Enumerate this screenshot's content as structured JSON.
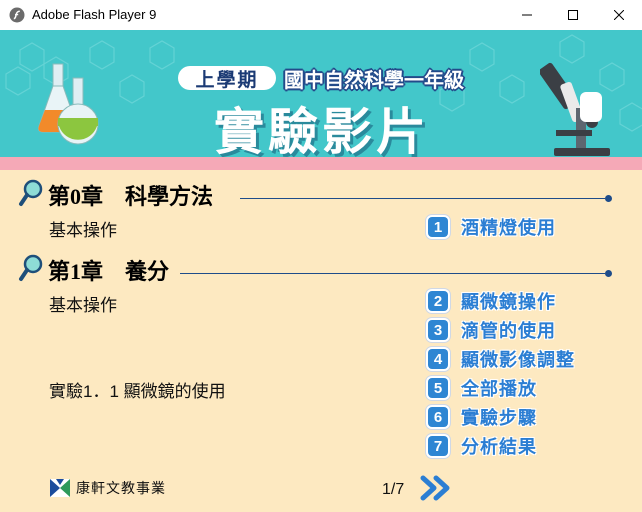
{
  "window": {
    "title": "Adobe Flash Player 9",
    "controls": [
      "minimize",
      "maximize",
      "close"
    ]
  },
  "banner": {
    "semester": "上學期",
    "course": "國中自然科學一年級",
    "title": "實驗影片"
  },
  "chapters": [
    {
      "title": "第0章　科學方法",
      "sections": [
        {
          "label": "基本操作"
        }
      ],
      "lessons": [
        {
          "num": "1",
          "label": "酒精燈使用"
        }
      ]
    },
    {
      "title": "第1章　養分",
      "sections": [
        {
          "label": "基本操作"
        },
        {
          "label": "實驗1．1 顯微鏡的使用"
        }
      ],
      "lessons": [
        {
          "num": "2",
          "label": "顯微鏡操作"
        },
        {
          "num": "3",
          "label": "滴管的使用"
        },
        {
          "num": "4",
          "label": "顯微影像調整"
        },
        {
          "num": "5",
          "label": "全部播放"
        },
        {
          "num": "6",
          "label": "實驗步驟"
        },
        {
          "num": "7",
          "label": "分析結果"
        }
      ]
    }
  ],
  "footer": {
    "publisher": "康軒文教事業",
    "page": "1/7"
  },
  "colors": {
    "banner": "#43c7ca",
    "band": "#f5a9b7",
    "background": "#fde9c1",
    "accent": "#2b7ed3",
    "rule": "#1e4c8a"
  },
  "icons": {
    "app": "flash-player-icon",
    "chapter": "magnifier-icon",
    "next": "double-chevron-right-icon",
    "publisher_logo": "kang-hsuan-logo",
    "decor_left": "flasks-icon",
    "decor_right": "microscope-icon"
  }
}
